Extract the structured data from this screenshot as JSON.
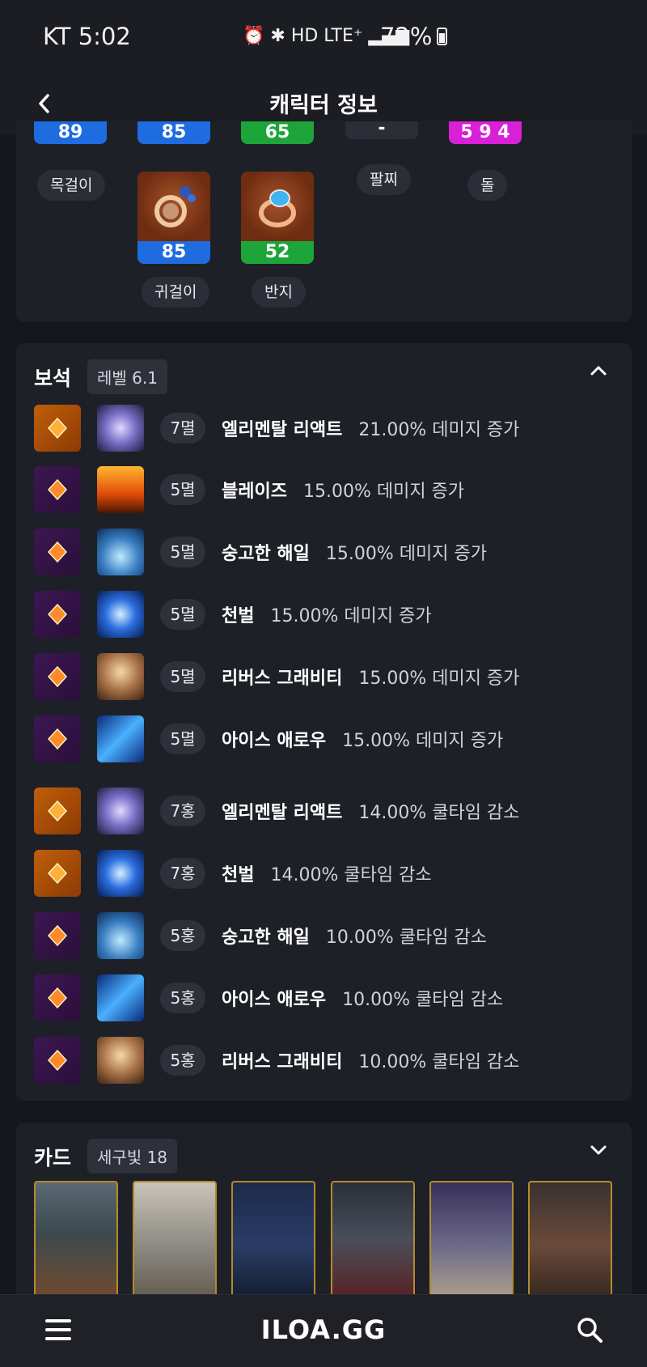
{
  "status": {
    "carrier_time": "KT 5:02",
    "icons": "⏰ ✱ HD LTE⁺ ▂▄▆",
    "battery": "72%"
  },
  "header": {
    "title": "캐릭터 정보",
    "back": "<"
  },
  "accessories": {
    "top_values": [
      {
        "value": "89",
        "color": "#1f6be0"
      },
      {
        "value": "85",
        "color": "#1f6be0"
      },
      {
        "value": "65",
        "color": "#1ea53a"
      },
      {
        "value": "-",
        "color": "#2b2e36"
      },
      {
        "value": "5 9 4",
        "color": "#d91fd7"
      }
    ],
    "labels": [
      "목걸이",
      "귀걸이",
      "반지",
      "팔찌",
      "돌"
    ],
    "icons": [
      {
        "name": "earring-icon",
        "value": "85"
      },
      {
        "name": "ring-icon",
        "value": "52"
      }
    ]
  },
  "gems": {
    "title": "보석",
    "level": "레벨 6.1",
    "rows": [
      {
        "gem": "orange",
        "skill": "sk-react",
        "level": "7멸",
        "name": "엘리멘탈 리액트",
        "effect": "21.00% 데미지 증가"
      },
      {
        "gem": "purple",
        "skill": "sk-blaze",
        "level": "5멸",
        "name": "블레이즈",
        "effect": "15.00% 데미지 증가"
      },
      {
        "gem": "purple",
        "skill": "sk-tide",
        "level": "5멸",
        "name": "숭고한 해일",
        "effect": "15.00% 데미지 증가"
      },
      {
        "gem": "purple",
        "skill": "sk-judg",
        "level": "5멸",
        "name": "천벌",
        "effect": "15.00% 데미지 증가"
      },
      {
        "gem": "purple",
        "skill": "sk-grav",
        "level": "5멸",
        "name": "리버스 그래비티",
        "effect": "15.00% 데미지 증가"
      },
      {
        "gem": "purple",
        "skill": "sk-arrow",
        "level": "5멸",
        "name": "아이스 애로우",
        "effect": "15.00% 데미지 증가"
      },
      {
        "gem": "orange",
        "skill": "sk-react",
        "level": "7홍",
        "name": "엘리멘탈 리액트",
        "effect": "14.00% 쿨타임 감소"
      },
      {
        "gem": "orange",
        "skill": "sk-judg",
        "level": "7홍",
        "name": "천벌",
        "effect": "14.00% 쿨타임 감소"
      },
      {
        "gem": "purple",
        "skill": "sk-tide",
        "level": "5홍",
        "name": "숭고한 해일",
        "effect": "10.00% 쿨타임 감소"
      },
      {
        "gem": "purple",
        "skill": "sk-arrow",
        "level": "5홍",
        "name": "아이스 애로우",
        "effect": "10.00% 쿨타임 감소"
      },
      {
        "gem": "purple",
        "skill": "sk-grav",
        "level": "5홍",
        "name": "리버스 그래비티",
        "effect": "10.00% 쿨타임 감소"
      }
    ]
  },
  "cards": {
    "title": "카드",
    "set": "세구빛 18",
    "items": [
      {
        "stars": "◆◆◆◆◆"
      },
      {
        "stars": "◆◆◆◆◆"
      },
      {
        "stars": "◆◆◆◆◆"
      },
      {
        "stars": "◆◆◆◆◆"
      },
      {
        "stars": "◆◆◆◆◆"
      },
      {
        "stars": "◆◆◆◆◆"
      }
    ]
  },
  "bottombar": {
    "logo": "ILOA.GG"
  }
}
